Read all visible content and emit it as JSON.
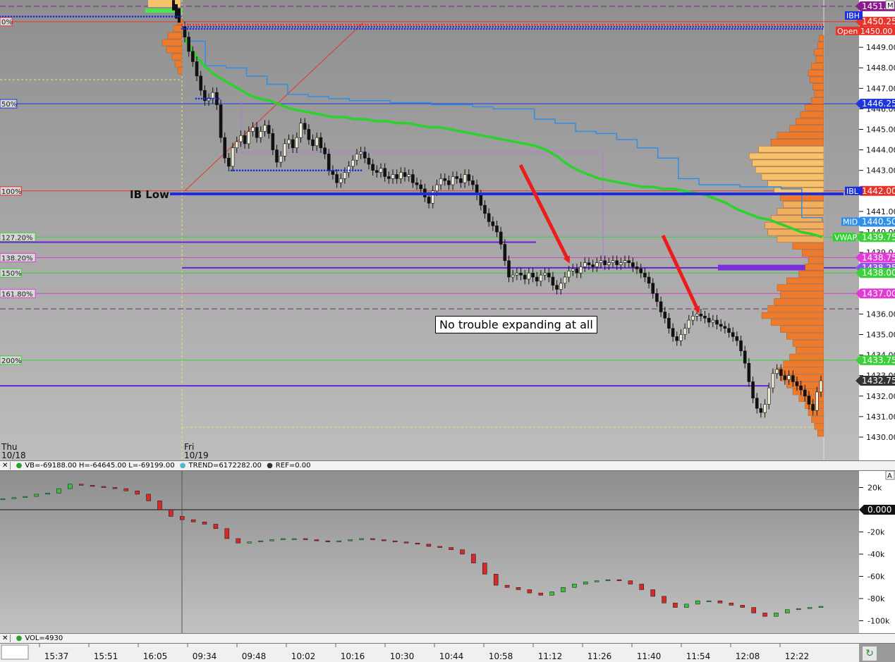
{
  "chart_data": [
    {
      "type": "candlestick",
      "panel": "price",
      "y_ticks": [
        1430,
        1431,
        1432,
        1433,
        1434,
        1435,
        1436,
        1437,
        1438,
        1439,
        1440,
        1441,
        1442,
        1443,
        1444,
        1445,
        1446,
        1447,
        1448,
        1449,
        1450,
        1451
      ],
      "y_tick_labels": [
        "1430.00",
        "1431.00",
        "1432.00",
        "1433.00",
        "1434.00",
        "1435.00",
        "1436.00",
        "1437.0",
        "1438.00",
        "1439.0",
        "1440.00",
        "1441.00",
        "1442.00",
        "1443.00",
        "1444.00",
        "1445.00",
        "1446.00",
        "1447.00",
        "1448.00",
        "1449.00",
        "1450.00",
        "1451.00"
      ],
      "ylim": [
        1429.3,
        1451.4
      ],
      "sessions": [
        {
          "day": "Thu",
          "date": "10/18"
        },
        {
          "day": "Fri",
          "date": "10/19"
        }
      ],
      "fib_levels": [
        {
          "label": "0%",
          "price": 1450.25,
          "color": "#e8332a"
        },
        {
          "label": "50%",
          "price": 1446.25,
          "color": "#1a35e0"
        },
        {
          "label": "100%",
          "price": 1442.0,
          "color": "#e8332a"
        },
        {
          "label": "127.20%",
          "price": 1439.75,
          "color": "#3ad13a"
        },
        {
          "label": "138.20%",
          "price": 1438.75,
          "color": "#e23ad6"
        },
        {
          "label": "150%",
          "price": 1438.0,
          "color": "#3ad13a"
        },
        {
          "label": "161.80%",
          "price": 1437.0,
          "color": "#e23ad6"
        },
        {
          "label": "200%",
          "price": 1433.75,
          "color": "#3ad13a"
        }
      ],
      "price_tags": [
        {
          "label": "1451.",
          "price": 1451.0,
          "color": "#8b1a8b"
        },
        {
          "label": "1450.25",
          "price": 1450.25,
          "color": "#e8332a"
        },
        {
          "label": "1446.25",
          "price": 1446.25,
          "color": "#1a35e0"
        },
        {
          "label": "1442.00",
          "price": 1442.0,
          "color": "#e8332a"
        },
        {
          "label": "1440.50",
          "price": 1440.5,
          "color": "#2f8ee8"
        },
        {
          "label": "1439.75",
          "price": 1439.75,
          "color": "#3ad13a"
        },
        {
          "label": "1438.75",
          "price": 1438.75,
          "color": "#e23ad6"
        },
        {
          "label": "1438.25",
          "price": 1438.25,
          "color": "#8b55e8"
        },
        {
          "label": "1438.00",
          "price": 1438.0,
          "color": "#3ad13a"
        },
        {
          "label": "1437.00",
          "price": 1437.0,
          "color": "#e23ad6"
        },
        {
          "label": "1433.75",
          "price": 1433.75,
          "color": "#3ad13a"
        },
        {
          "label": "1432.75",
          "price": 1432.75,
          "color": "#333333"
        }
      ],
      "side_labels": {
        "ibl": "IBL",
        "mid": "MID",
        "vwap": "VWAP",
        "open": "Open",
        "open_value": "1450.00",
        "top_marker": "M",
        "ibh": "IBH"
      },
      "ib_low_label": "IB Low",
      "annotation": "No trouble expanding at all",
      "close": [
        1449.5,
        1448.8,
        1448.3,
        1447.6,
        1446.9,
        1446.4,
        1446.5,
        1446.8,
        1446.2,
        1444.6,
        1443.6,
        1443.2,
        1444.1,
        1444.4,
        1444.7,
        1444.3,
        1444.9,
        1445.1,
        1444.6,
        1444.9,
        1445.2,
        1444.8,
        1444.0,
        1443.4,
        1443.7,
        1444.3,
        1444.5,
        1444.1,
        1444.6,
        1445.3,
        1445.0,
        1444.5,
        1444.2,
        1444.6,
        1444.1,
        1443.8,
        1443.0,
        1442.8,
        1442.4,
        1442.6,
        1442.9,
        1443.2,
        1443.5,
        1443.8,
        1443.9,
        1443.6,
        1443.3,
        1443.0,
        1442.9,
        1443.1,
        1442.7,
        1442.6,
        1442.8,
        1442.6,
        1442.9,
        1442.7,
        1442.8,
        1442.4,
        1442.3,
        1442.1,
        1441.7,
        1441.4,
        1442.0,
        1442.3,
        1442.6,
        1442.5,
        1442.3,
        1442.7,
        1442.6,
        1442.4,
        1442.8,
        1442.5,
        1442.3,
        1441.8,
        1441.3,
        1440.9,
        1440.5,
        1440.3,
        1440.0,
        1439.4,
        1438.6,
        1437.8,
        1437.9,
        1438.0,
        1437.9,
        1437.7,
        1438.0,
        1437.8,
        1437.6,
        1437.9,
        1438.0,
        1437.8,
        1437.4,
        1437.2,
        1437.5,
        1437.8,
        1438.1,
        1438.2,
        1438.0,
        1438.3,
        1438.5,
        1438.4,
        1438.3,
        1438.5,
        1438.6,
        1438.4,
        1438.5,
        1438.6,
        1438.4,
        1438.5,
        1438.6,
        1438.5,
        1438.3,
        1438.2,
        1438.0,
        1437.8,
        1437.5,
        1437.0,
        1436.6,
        1436.1,
        1435.8,
        1435.3,
        1434.9,
        1434.7,
        1435.0,
        1435.3,
        1435.7,
        1435.9,
        1436.0,
        1435.9,
        1435.8,
        1435.6,
        1435.7,
        1435.5,
        1435.4,
        1435.3,
        1435.1,
        1434.9,
        1434.7,
        1434.2,
        1433.6,
        1432.7,
        1431.9,
        1431.4,
        1431.2,
        1431.6,
        1432.4,
        1433.1,
        1433.3,
        1433.0,
        1432.8,
        1433.0,
        1432.7,
        1432.5,
        1432.3,
        1432.0,
        1431.6,
        1431.3,
        1432.2,
        1432.75
      ],
      "vwap": [
        1449.4,
        1448.6,
        1448.0,
        1447.6,
        1447.3,
        1447.0,
        1446.7,
        1446.5,
        1446.4,
        1446.2,
        1446.0,
        1445.9,
        1445.8,
        1445.7,
        1445.6,
        1445.6,
        1445.5,
        1445.5,
        1445.4,
        1445.4,
        1445.3,
        1445.3,
        1445.2,
        1445.1,
        1445.1,
        1445.0,
        1444.9,
        1444.8,
        1444.7,
        1444.6,
        1444.5,
        1444.4,
        1444.3,
        1444.2,
        1444.0,
        1443.7,
        1443.3,
        1443.0,
        1442.8,
        1442.6,
        1442.5,
        1442.4,
        1442.3,
        1442.2,
        1442.2,
        1442.1,
        1442.1,
        1442.0,
        1441.9,
        1441.8,
        1441.6,
        1441.4,
        1441.1,
        1440.9,
        1440.7,
        1440.6,
        1440.4,
        1440.2,
        1440.0,
        1439.9,
        1439.75
      ],
      "mid_line": [
        1449.3,
        1448.1,
        1448.0,
        1447.6,
        1447.2,
        1446.7,
        1446.6,
        1446.5,
        1446.4,
        1446.4,
        1446.3,
        1446.3,
        1446.2,
        1446.2,
        1446.1,
        1446.0,
        1446.0,
        1445.5,
        1445.3,
        1444.9,
        1444.8,
        1444.5,
        1444.1,
        1443.6,
        1442.6,
        1442.3,
        1442.3,
        1442.2,
        1442.2,
        1442.1,
        1440.7,
        1440.5
      ],
      "volume_profile": [
        3,
        4,
        6,
        5,
        8,
        10,
        9,
        7,
        6,
        8,
        12,
        15,
        18,
        22,
        30,
        34,
        42,
        48,
        46,
        44,
        40,
        36,
        32,
        28,
        26,
        30,
        34,
        38,
        36,
        30,
        20,
        14,
        10,
        12,
        16,
        24,
        30,
        28,
        32,
        36,
        40,
        34,
        28,
        24,
        20,
        18,
        22,
        26,
        30,
        28,
        24,
        20,
        16,
        12,
        10,
        8,
        6,
        4
      ]
    },
    {
      "type": "line",
      "panel": "indicator",
      "legend": [
        {
          "text": "VB=-69188.00 H=-64645.00 L=-69199.00",
          "color": "#2e9e2e"
        },
        {
          "text": "TREND=6172282.00",
          "color": "#4fb6d6"
        },
        {
          "text": "REF=0.00",
          "color": "#333333"
        }
      ],
      "y_ticks": [
        20000,
        0,
        -20000,
        -40000,
        -60000,
        -80000,
        -100000
      ],
      "y_tick_labels": [
        "20k",
        "0.000",
        "-20k",
        "-40k",
        "-60k",
        "-80k",
        "-100k"
      ],
      "ylim": [
        -105000,
        28000
      ],
      "corner_label": "A",
      "values": [
        10000,
        11000,
        12000,
        14000,
        15000,
        19000,
        23000,
        22000,
        21000,
        20000,
        19000,
        17000,
        14000,
        8000,
        0,
        -6000,
        -9000,
        -11000,
        -13000,
        -17000,
        -26000,
        -30000,
        -29000,
        -28000,
        -27000,
        -26000,
        -26000,
        -27000,
        -28000,
        -29000,
        -28000,
        -27000,
        -26000,
        -27000,
        -28000,
        -29000,
        -30000,
        -31000,
        -33000,
        -34000,
        -36000,
        -40000,
        -48000,
        -58000,
        -68000,
        -70000,
        -72000,
        -75000,
        -77000,
        -74000,
        -70000,
        -67000,
        -65000,
        -64000,
        -63000,
        -64000,
        -67000,
        -72000,
        -78000,
        -84000,
        -88000,
        -85000,
        -82000,
        -82000,
        -84000,
        -86000,
        -88000,
        -93000,
        -96000,
        -93000,
        -90000,
        -89000,
        -88000,
        -87000
      ]
    }
  ],
  "volume_legend": {
    "text": "VOL=4930",
    "color": "#2e9e2e"
  },
  "x_labels": [
    "15:37",
    "15:51",
    "16:05",
    "09:34",
    "09:48",
    "10:02",
    "10:16",
    "10:30",
    "10:44",
    "10:58",
    "11:12",
    "11:26",
    "11:40",
    "11:54",
    "12:08",
    "12:22"
  ]
}
